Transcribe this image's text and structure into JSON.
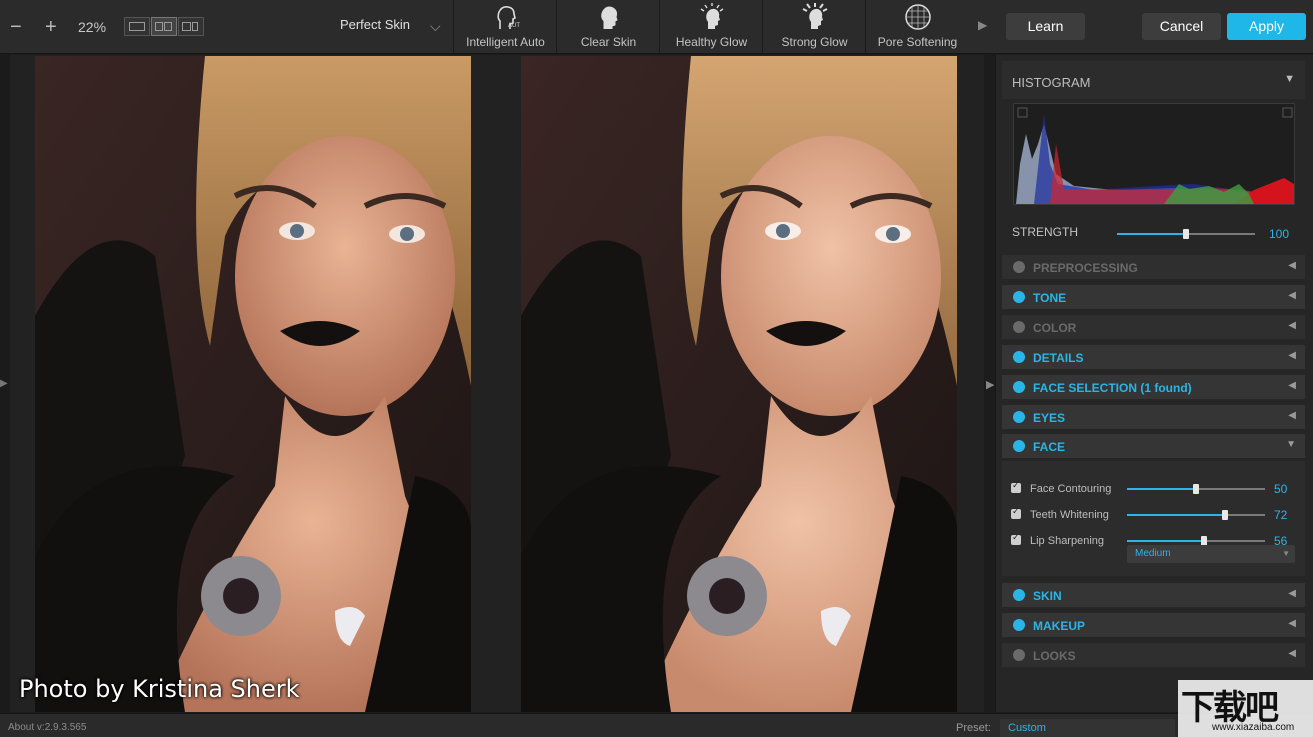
{
  "toolbar": {
    "zoom": "22%",
    "preset_name": "Perfect Skin",
    "presets": [
      {
        "label": "Intelligent Auto",
        "icon": "auto-face-icon"
      },
      {
        "label": "Clear Skin",
        "icon": "clear-skin-face-icon"
      },
      {
        "label": "Healthy Glow",
        "icon": "healthy-glow-face-icon"
      },
      {
        "label": "Strong Glow",
        "icon": "strong-glow-face-icon"
      },
      {
        "label": "Pore Softening",
        "icon": "pore-softening-icon"
      }
    ],
    "learn_label": "Learn",
    "cancel_label": "Cancel",
    "apply_label": "Apply"
  },
  "canvas": {
    "credit": "Photo by Kristina Sherk"
  },
  "panel": {
    "histogram_title": "HISTOGRAM",
    "strength": {
      "label": "STRENGTH",
      "value": "100",
      "level": 0.5
    },
    "sections": [
      {
        "name": "PREPROCESSING",
        "enabled": false,
        "expanded": false
      },
      {
        "name": "TONE",
        "enabled": true,
        "expanded": false
      },
      {
        "name": "COLOR",
        "enabled": false,
        "expanded": false
      },
      {
        "name": "DETAILS",
        "enabled": true,
        "expanded": false
      },
      {
        "name": "FACE SELECTION (1 found)",
        "enabled": true,
        "expanded": false
      },
      {
        "name": "EYES",
        "enabled": true,
        "expanded": false
      },
      {
        "name": "FACE",
        "enabled": true,
        "expanded": true
      },
      {
        "name": "SKIN",
        "enabled": true,
        "expanded": false
      },
      {
        "name": "MAKEUP",
        "enabled": true,
        "expanded": false
      },
      {
        "name": "LOOKS",
        "enabled": false,
        "expanded": false
      }
    ],
    "face_controls": [
      {
        "label": "Face Contouring",
        "value": "50",
        "level": 0.5
      },
      {
        "label": "Teeth Whitening",
        "value": "72",
        "level": 0.71
      },
      {
        "label": "Lip Sharpening",
        "value": "56",
        "level": 0.56
      }
    ],
    "face_mode": "Medium"
  },
  "statusbar": {
    "version": "About v:2.9.3.565",
    "preset_label": "Preset:",
    "preset_value": "Custom"
  },
  "watermark": {
    "brand": "下载吧",
    "url": "www.xiazaiba.com"
  },
  "colors": {
    "accent": "#2bb5e6",
    "apply": "#1fb6e8"
  }
}
